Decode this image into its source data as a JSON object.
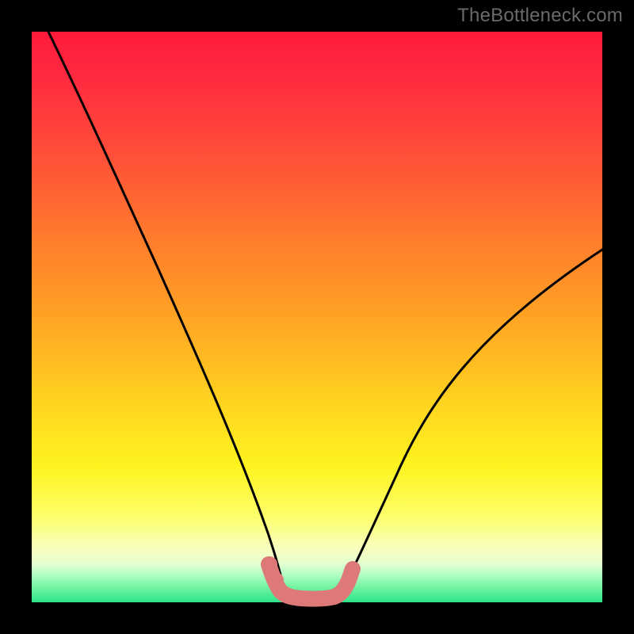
{
  "watermark": {
    "text": "TheBottleneck.com"
  },
  "chart_data": {
    "type": "line",
    "title": "",
    "xlabel": "",
    "ylabel": "",
    "xlim": [
      0,
      100
    ],
    "ylim": [
      0,
      100
    ],
    "grid": false,
    "legend": false,
    "series": [
      {
        "name": "bottleneck-curve",
        "x": [
          3,
          10,
          18,
          26,
          33,
          38,
          41,
          42.5,
          44,
          45,
          46,
          48,
          50,
          52,
          54,
          56,
          60,
          66,
          74,
          82,
          90,
          100
        ],
        "values": [
          100,
          85,
          69,
          52,
          36,
          22,
          11,
          5,
          1.5,
          0.5,
          0.5,
          0.5,
          0.5,
          1,
          3,
          7,
          14,
          24,
          36,
          46,
          54,
          62
        ]
      },
      {
        "name": "flat-marker-band",
        "x": [
          41.5,
          42.5,
          43.5,
          45,
          47,
          49,
          51,
          53,
          54,
          55
        ],
        "values": [
          6.5,
          4,
          2,
          1,
          1,
          1,
          1,
          1.5,
          3,
          5
        ]
      }
    ],
    "colors": {
      "curve": "#000000",
      "marker": "#dd7a78",
      "background_top": "#ff1a3a",
      "background_bottom": "#2ee38a"
    }
  }
}
